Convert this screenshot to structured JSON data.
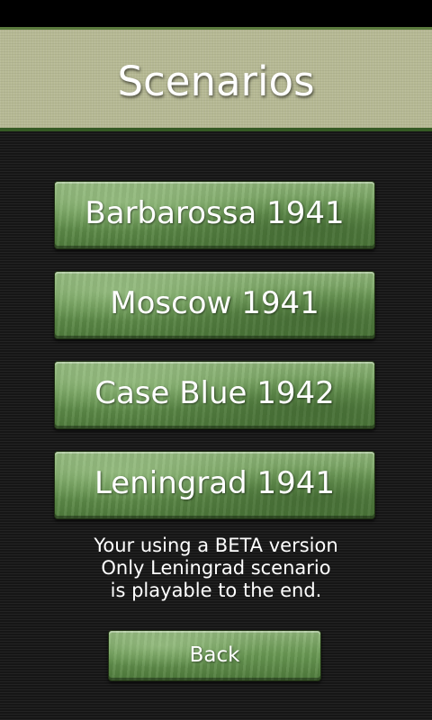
{
  "header": {
    "title": "Scenarios"
  },
  "scenarios": [
    {
      "label": "Barbarossa 1941"
    },
    {
      "label": "Moscow 1941"
    },
    {
      "label": "Case Blue 1942"
    },
    {
      "label": "Leningrad 1941"
    }
  ],
  "notice": {
    "lines": [
      "Your using a BETA version",
      "Only Leningrad scenario",
      "is playable to the end."
    ]
  },
  "back": {
    "label": "Back"
  },
  "colors": {
    "header_bg": "#b6b994",
    "button_green": "#6b9a55",
    "background": "#1b1b1b",
    "text": "#ffffff"
  }
}
